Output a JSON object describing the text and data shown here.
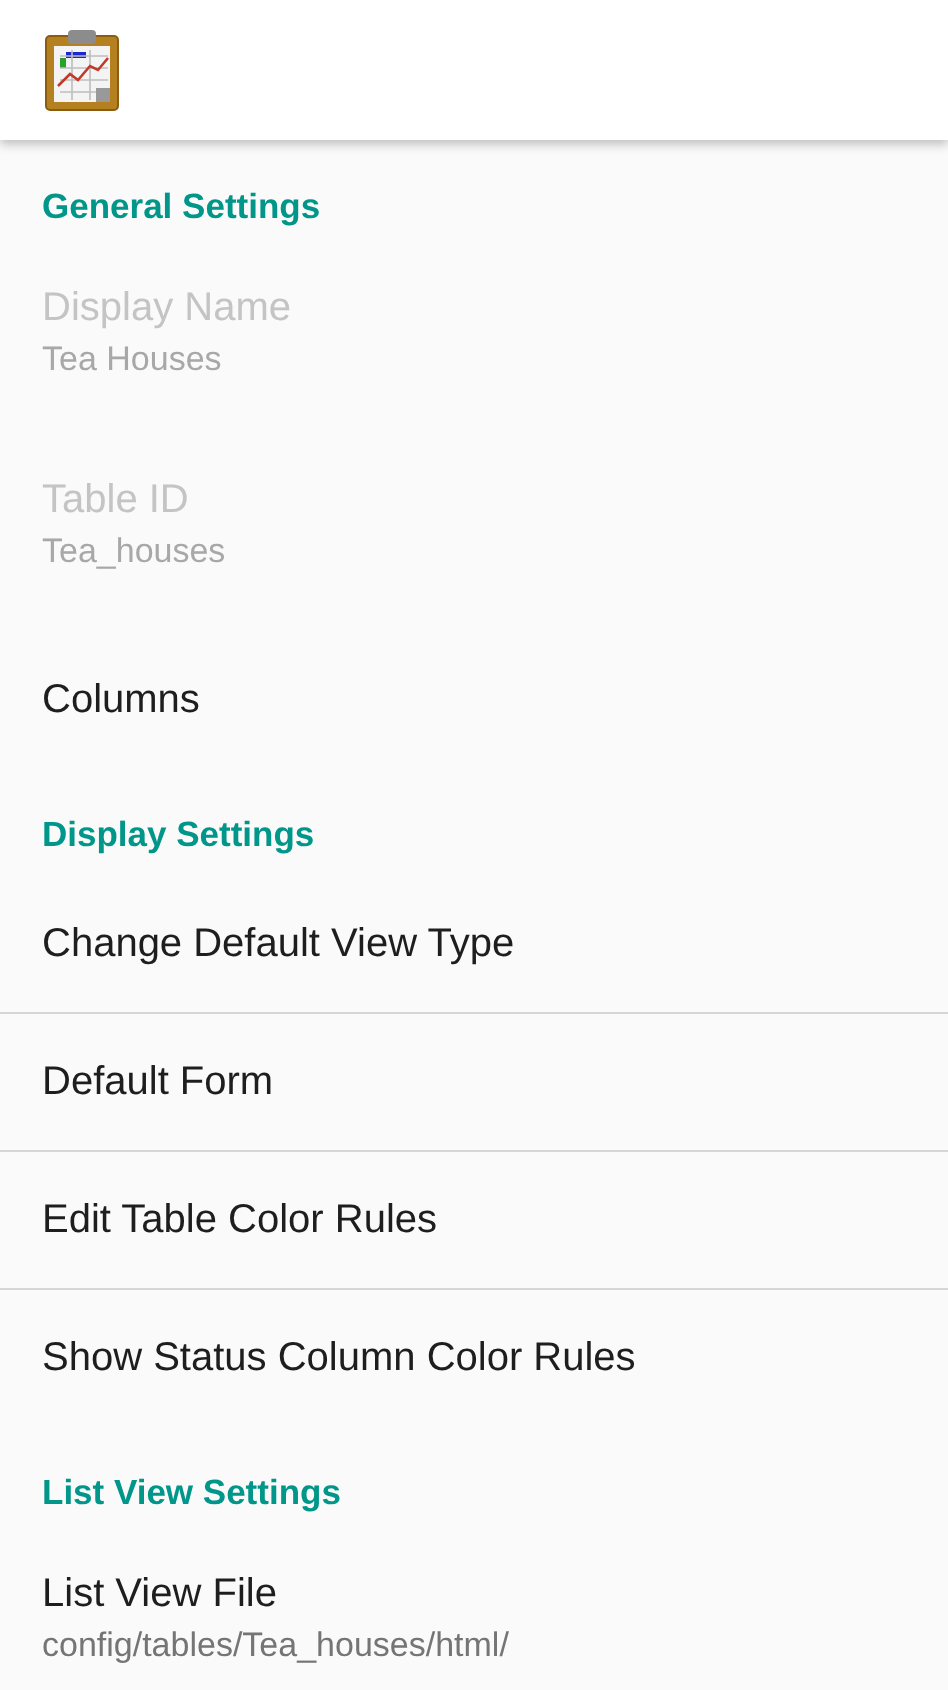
{
  "sections": [
    {
      "title": "General Settings",
      "items": [
        {
          "title": "Display Name",
          "summary": "Tea Houses",
          "disabled": true
        },
        {
          "title": "Table ID",
          "summary": "Tea_houses",
          "disabled": true
        },
        {
          "title": "Columns",
          "disabled": false
        }
      ]
    },
    {
      "title": "Display Settings",
      "items": [
        {
          "title": "Change Default View Type",
          "disabled": false,
          "divider": true
        },
        {
          "title": "Default Form",
          "disabled": false,
          "divider": true
        },
        {
          "title": "Edit Table Color Rules",
          "disabled": false,
          "divider": true
        },
        {
          "title": "Show Status Column Color Rules",
          "disabled": false,
          "divider": false
        }
      ]
    },
    {
      "title": "List View Settings",
      "items": [
        {
          "title": "List View File",
          "summary": "config/tables/Tea_houses/html/",
          "disabled": false
        }
      ]
    }
  ]
}
